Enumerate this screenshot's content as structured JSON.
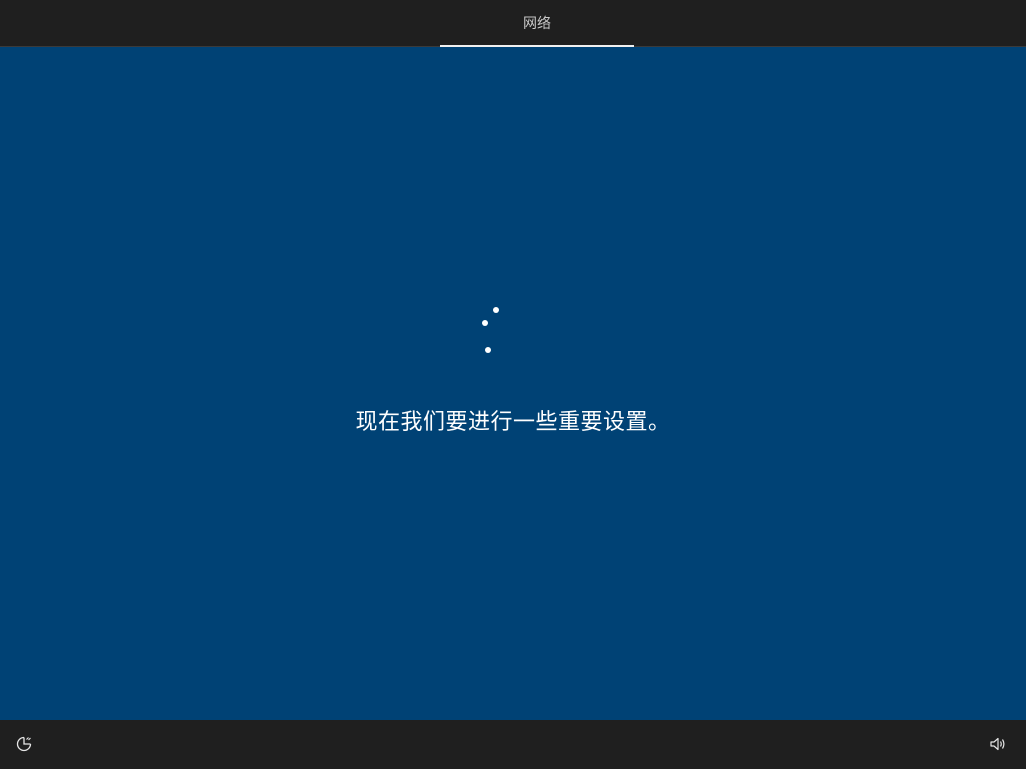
{
  "header": {
    "active_tab": "网络"
  },
  "main": {
    "message": "现在我们要进行一些重要设置。",
    "spinner_icon": "loading-dots-icon"
  },
  "footer": {
    "left_icon": "ease-of-access-icon",
    "right_icon": "volume-icon"
  },
  "colors": {
    "background": "#004275",
    "bars": "#1f1f1f",
    "text": "#ffffff"
  }
}
